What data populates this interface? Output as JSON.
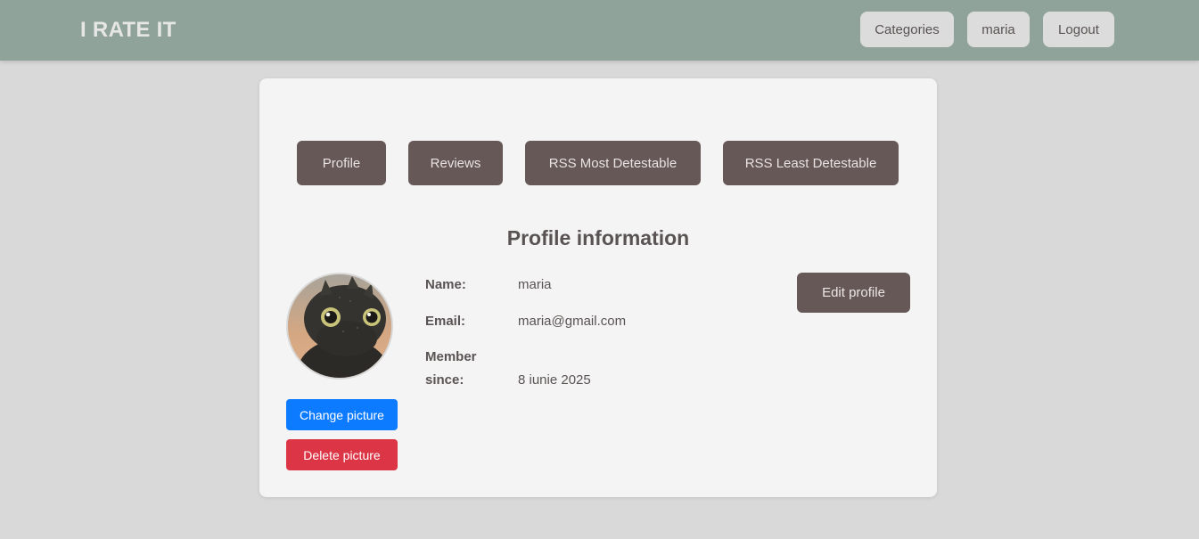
{
  "header": {
    "brand": "I RATE IT",
    "nav": {
      "categories": "Categories",
      "user": "maria",
      "logout": "Logout"
    }
  },
  "tabs": {
    "profile": "Profile",
    "reviews": "Reviews",
    "rss_most": "RSS Most Detestable",
    "rss_least": "RSS Least Detestable"
  },
  "profile": {
    "heading": "Profile information",
    "name_label": "Name:",
    "name_value": "maria",
    "email_label": "Email:",
    "email_value": "maria@gmail.com",
    "member_label_1": "Member",
    "member_label_2": "since:",
    "member_value": "8 iunie 2025",
    "edit_button": "Edit profile",
    "change_picture": "Change picture",
    "delete_picture": "Delete picture"
  },
  "colors": {
    "header_bg": "#8fa39a",
    "page_bg": "#d9d9d9",
    "card_bg": "#f4f4f4",
    "tab_bg": "#655857",
    "change_btn": "#0d7bff",
    "delete_btn": "#dc3545"
  }
}
